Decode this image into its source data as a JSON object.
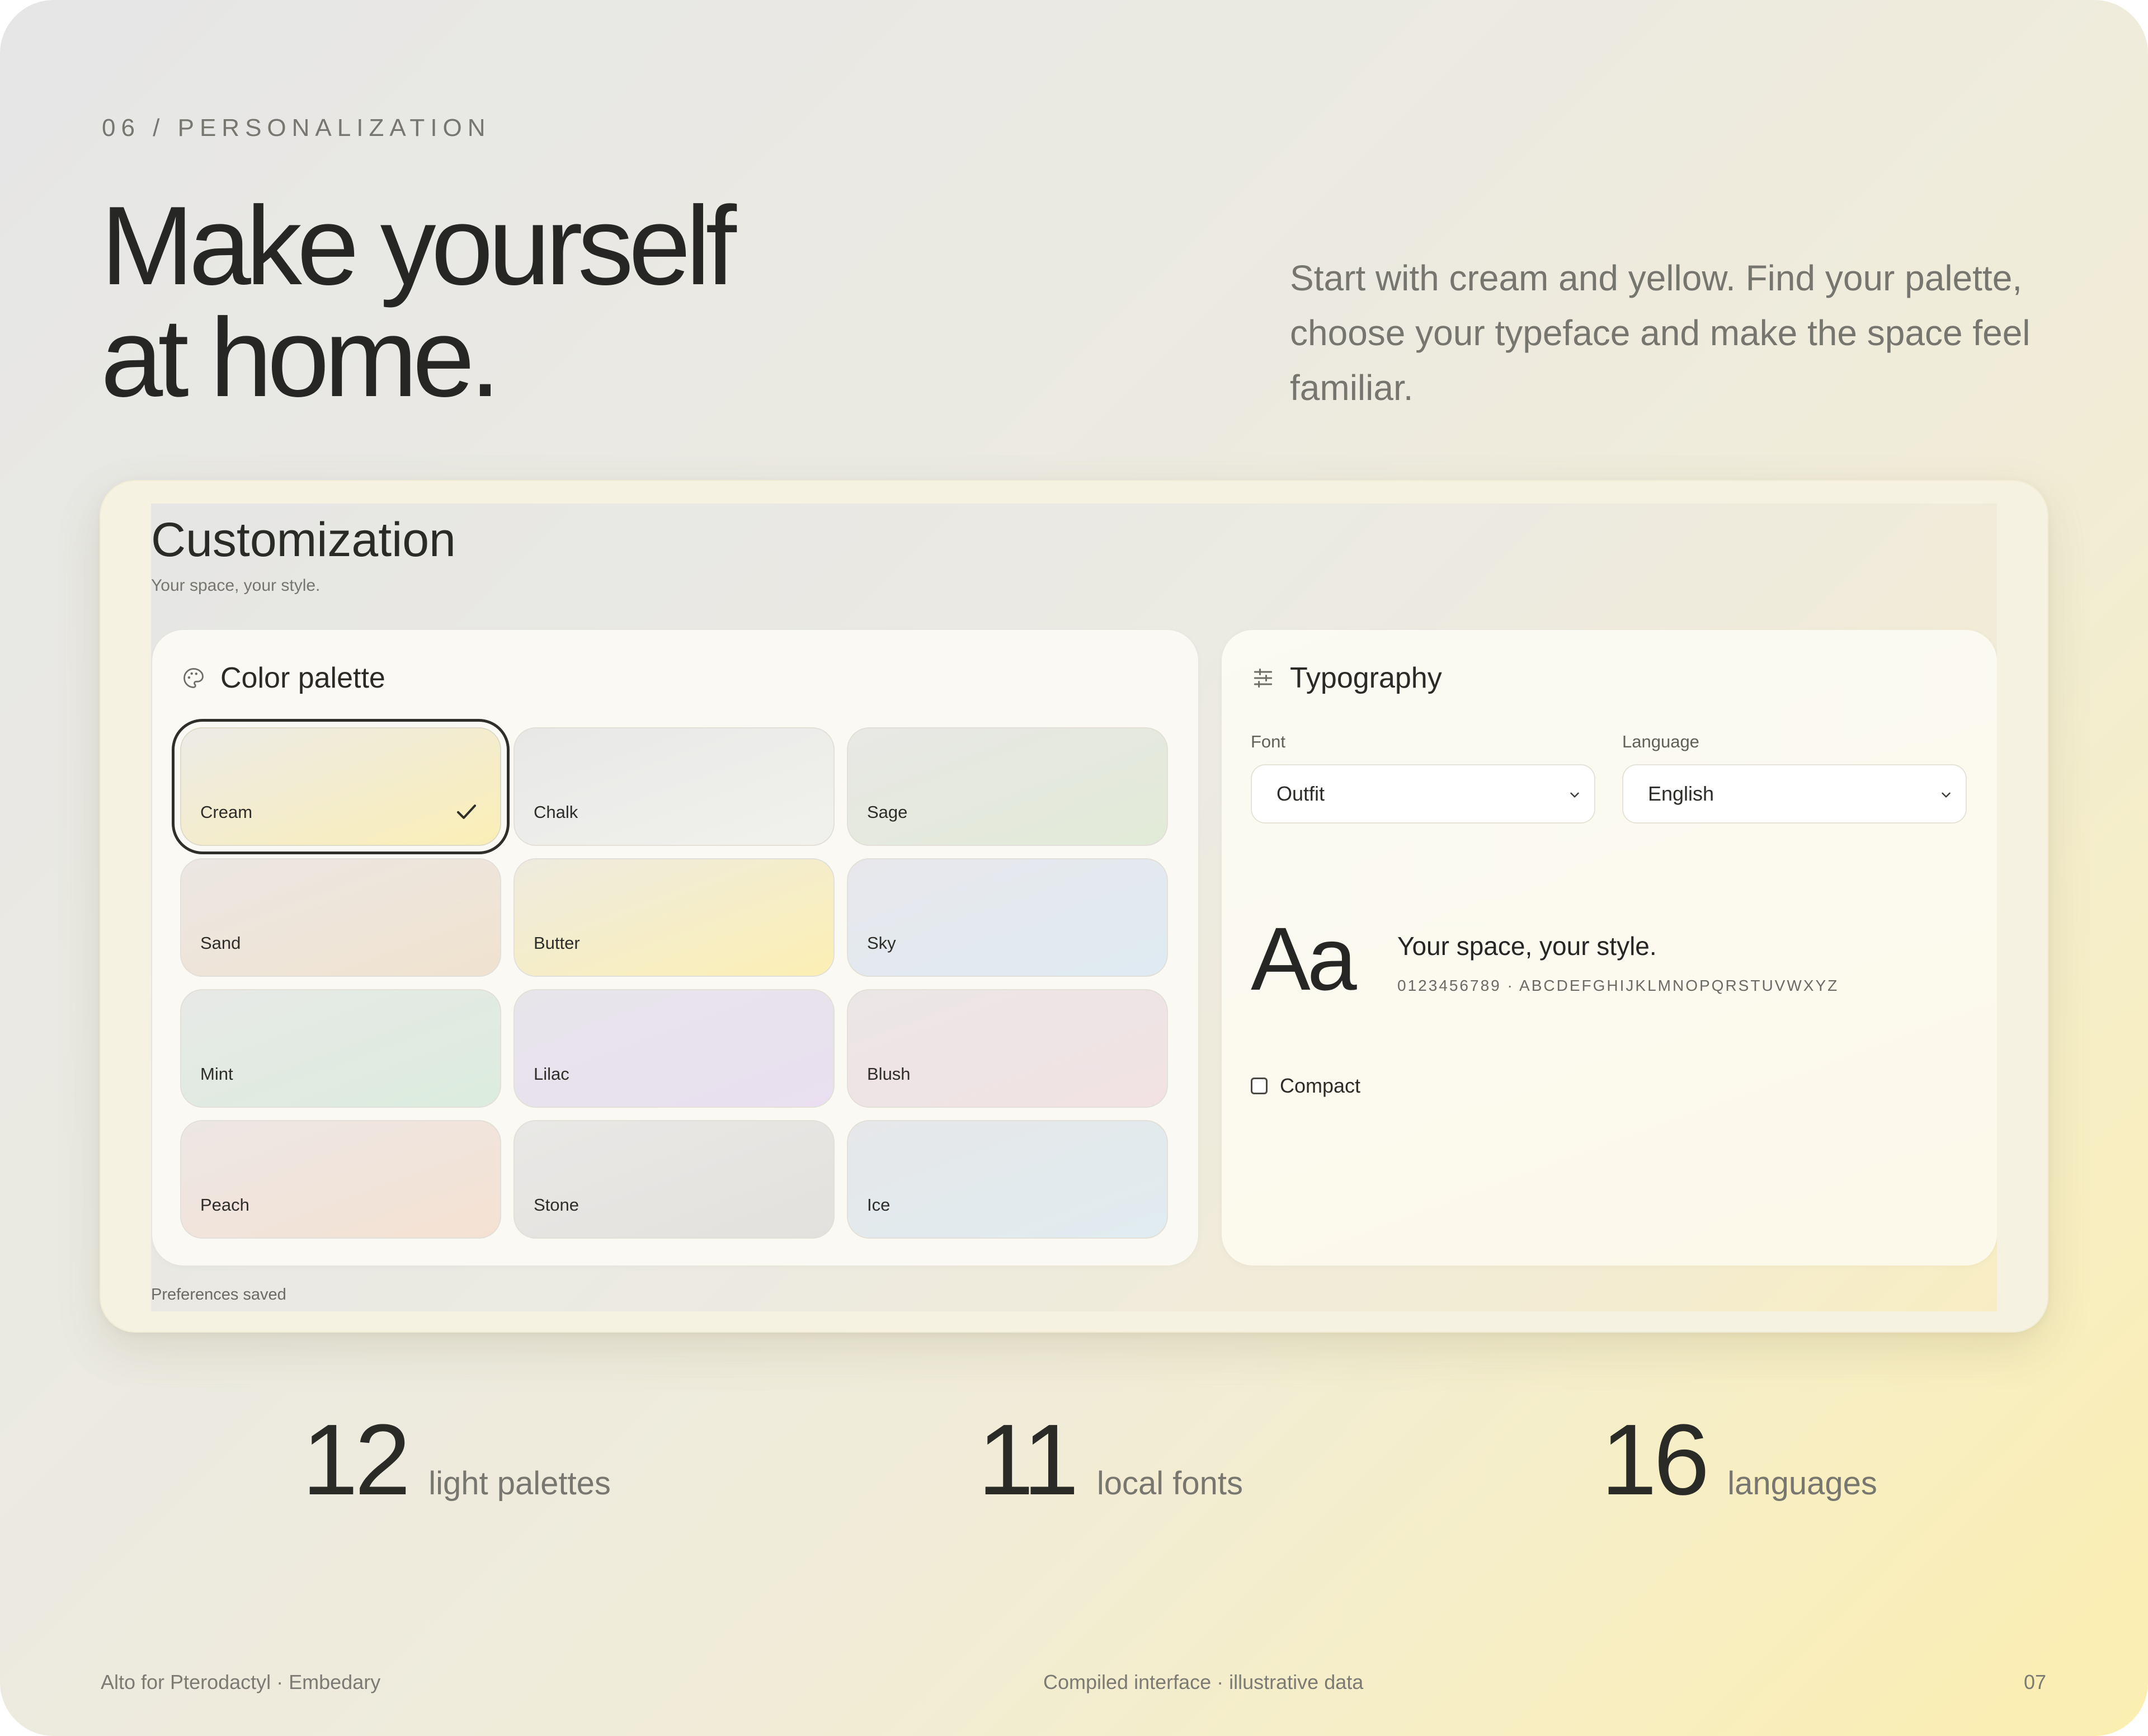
{
  "page": {
    "eyebrow": "06 / PERSONALIZATION",
    "headline": [
      "Make yourself",
      "at home."
    ],
    "intro": "Start with cream and yellow. Find your palette, choose your typeface and make the space feel familiar."
  },
  "app": {
    "title": "Customization",
    "subtitle": "Your space, your style.",
    "status": "Preferences saved",
    "palette": {
      "heading": "Color palette",
      "icon": "palette-icon",
      "selected": "Cream",
      "swatches": [
        {
          "name": "Cream",
          "from": "#ecebe6",
          "to": "#fbeeb6"
        },
        {
          "name": "Chalk",
          "from": "#e8e8e7",
          "to": "#f1f1ed"
        },
        {
          "name": "Sage",
          "from": "#e8e8e5",
          "to": "#e2ead7"
        },
        {
          "name": "Sand",
          "from": "#ece7e3",
          "to": "#f0e2cf"
        },
        {
          "name": "Butter",
          "from": "#eeebdf",
          "to": "#fcefb4"
        },
        {
          "name": "Sky",
          "from": "#e8e8ec",
          "to": "#dfeaf2"
        },
        {
          "name": "Mint",
          "from": "#e8e9e7",
          "to": "#dbecde"
        },
        {
          "name": "Lilac",
          "from": "#e7e5ea",
          "to": "#e9dff0"
        },
        {
          "name": "Blush",
          "from": "#ebe6e6",
          "to": "#f2e2e4"
        },
        {
          "name": "Peach",
          "from": "#ece7e4",
          "to": "#f5e1d2"
        },
        {
          "name": "Stone",
          "from": "#e9e8e6",
          "to": "#e3e1dd"
        },
        {
          "name": "Ice",
          "from": "#e6e7e9",
          "to": "#e0ecf0"
        }
      ]
    },
    "typography": {
      "heading": "Typography",
      "icon": "sliders-icon",
      "font_label": "Font",
      "font_value": "Outfit",
      "language_label": "Language",
      "language_value": "English",
      "preview_glyph": "Aa",
      "preview_sample": "Your space, your style.",
      "preview_glyphs": "0123456789 · ABCDEFGHIJKLMNOPQRSTUVWXYZ",
      "compact_label": "Compact",
      "compact_checked": false
    }
  },
  "stats": [
    {
      "value": "12",
      "label": "light palettes"
    },
    {
      "value": "11",
      "label": "local fonts"
    },
    {
      "value": "16",
      "label": "languages"
    }
  ],
  "footer": {
    "left": "Alto for Pterodactyl · Embedary",
    "center": "Compiled interface · illustrative data",
    "right": "07"
  }
}
